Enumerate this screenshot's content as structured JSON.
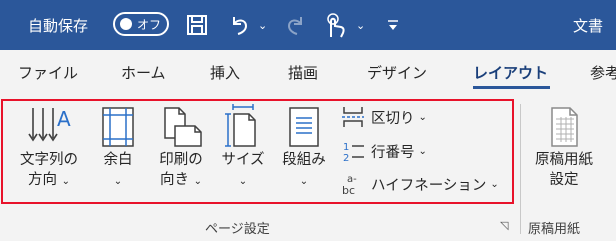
{
  "titlebar": {
    "autosave_label": "自動保存",
    "toggle_state": "オフ",
    "doc_title": "文書",
    "icons": [
      "save-icon",
      "undo-icon",
      "redo-icon",
      "touch-mode-icon",
      "customize-qat-icon"
    ]
  },
  "tabs": [
    {
      "label": "ファイル"
    },
    {
      "label": "ホーム"
    },
    {
      "label": "挿入"
    },
    {
      "label": "描画"
    },
    {
      "label": "デザイン"
    },
    {
      "label": "レイアウト",
      "active": true
    },
    {
      "label": "参考"
    }
  ],
  "page_setup": {
    "group_label": "ページ設定",
    "text_direction": {
      "line1": "文字列の",
      "line2": "方向"
    },
    "margins": {
      "line1": "余白"
    },
    "orientation": {
      "line1": "印刷の",
      "line2": "向き"
    },
    "size": {
      "line1": "サイズ"
    },
    "columns": {
      "line1": "段組み"
    },
    "breaks": "区切り",
    "line_numbers": "行番号",
    "hyphenation": "ハイフネーション"
  },
  "genko": {
    "group_label": "原稿用紙",
    "button": {
      "line1": "原稿用紙",
      "line2": "設定"
    }
  },
  "colors": {
    "titlebar": "#2b579a",
    "highlight_box": "#e8122a"
  }
}
